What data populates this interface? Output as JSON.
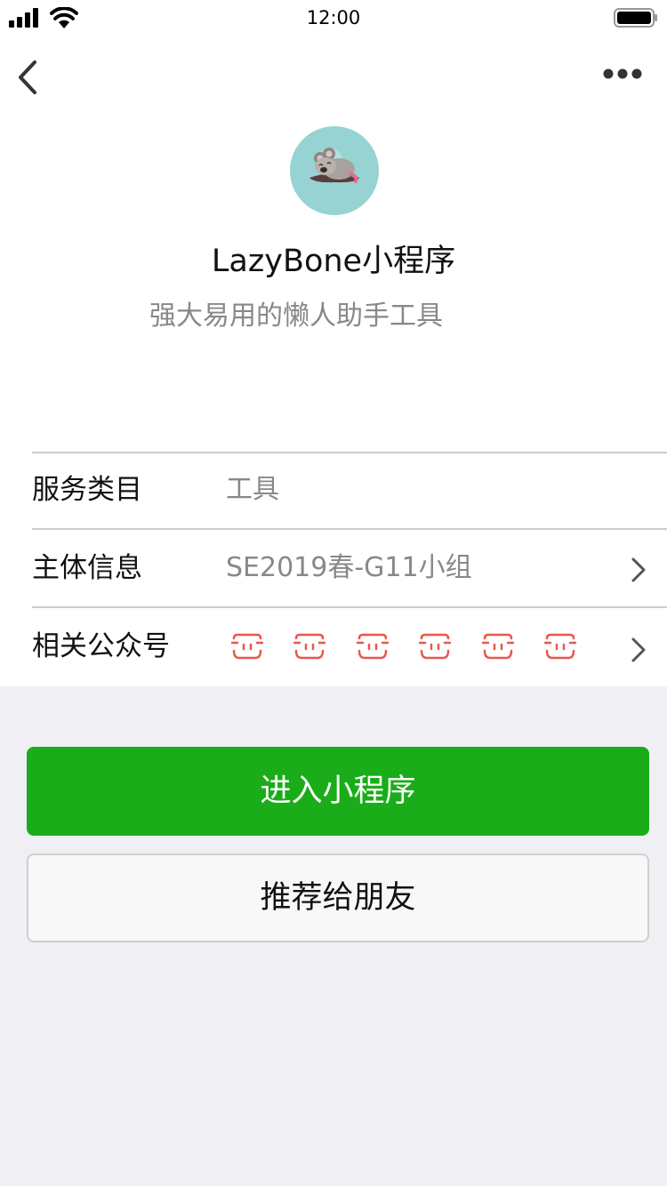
{
  "status_bar": {
    "time": "12:00"
  },
  "nav": {
    "back_icon": "chevron-left-icon",
    "more_icon": "more-dots-icon"
  },
  "header": {
    "app_name": "LazyBone小程序",
    "description": "强大易用的懒人助手工具",
    "avatar_icon": "koala-icon"
  },
  "info_rows": {
    "category": {
      "label": "服务类目",
      "value": "工具"
    },
    "subject": {
      "label": "主体信息",
      "value": "SE2019春-G11小组"
    },
    "accounts": {
      "label": "相关公众号",
      "icon": "official-account-icon",
      "count": 6
    }
  },
  "actions": {
    "enter_label": "进入小程序",
    "share_label": "推荐给朋友"
  },
  "colors": {
    "primary_green": "#1AAD19",
    "avatar_bg": "#97D3D2",
    "account_icon": "#E8574E",
    "page_bg": "#EFEFF4"
  }
}
